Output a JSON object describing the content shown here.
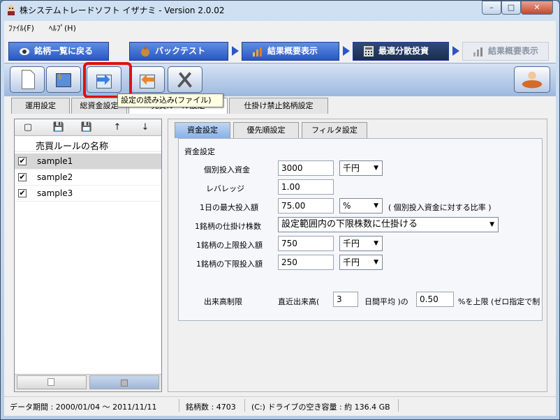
{
  "window": {
    "title": "株システムトレードソフト イザナミ - Version 2.0.02",
    "minimize_glyph": "–",
    "maximize_glyph": "□",
    "close_glyph": "✕"
  },
  "menu": [
    "ﾌｧｲﾙ(F)",
    "ﾍﾙﾌﾟ(H)"
  ],
  "nav_tabs": [
    {
      "label": "銘柄一覧に戻る",
      "icon": "eye-icon"
    },
    {
      "label": "バックテスト",
      "icon": "money-bag-icon"
    },
    {
      "label": "結果概要表示",
      "icon": "chart-icon"
    },
    {
      "label": "最適分散投資",
      "icon": "calculator-icon"
    },
    {
      "label": "結果概要表示",
      "icon": "chart-icon"
    }
  ],
  "toolbar": {
    "tooltip": "設定の読み込み(ファイル)",
    "buttons": [
      "new-document-icon",
      "currency-icon",
      "import-icon",
      "export-icon",
      "tools-icon"
    ],
    "right_button": "trader-icon"
  },
  "sub_tabs": [
    "運用設定",
    "総資金設定",
    "売買ルール設定",
    "仕掛け禁止銘柄設定"
  ],
  "rule_list": {
    "toolbar_glyphs": [
      "▢",
      "💾",
      "💾",
      "↑",
      "↓"
    ],
    "header": "売買ルールの名称",
    "check_glyph": "✔",
    "rows": [
      {
        "name": "sample1",
        "checked": true,
        "selected": true
      },
      {
        "name": "sample2",
        "checked": true,
        "selected": false
      },
      {
        "name": "sample3",
        "checked": true,
        "selected": false
      }
    ]
  },
  "right_tabs": [
    "資金設定",
    "優先順設定",
    "フィルタ設定"
  ],
  "fund": {
    "group_title": "資金設定",
    "fields": [
      {
        "label": "個別投入資金",
        "value": "3000",
        "unit": "千円"
      },
      {
        "label": "レバレッジ",
        "value": "1.00",
        "unit": ""
      },
      {
        "label": "1日の最大投入額",
        "value": "75.00",
        "unit": "%",
        "note": "( 個別投入資金に対する比率 )"
      },
      {
        "label": "1銘柄の仕掛け株数",
        "select": "設定範囲内の下限株数に仕掛ける"
      },
      {
        "label": "1銘柄の上限投入額",
        "value": "750",
        "unit": "千円"
      },
      {
        "label": "1銘柄の下限投入額",
        "value": "250",
        "unit": "千円"
      }
    ],
    "volume": {
      "label": "出来高制限",
      "text1": "直近出来高(",
      "days": "3",
      "text2": "日間平均 )の",
      "ratio": "0.50",
      "text3": "%を上限 (ゼロ指定で制"
    }
  },
  "status": {
    "period": "データ期間 : 2000/01/04 ～ 2011/11/11",
    "count": "銘柄数 : 4703",
    "disk": "(C:) ドライブの空き容量 : 約 136.4 GB"
  },
  "colors": {
    "highlight": "#e01010",
    "nav_blue": "#2a56c6",
    "active_tab": "#1b2c4f"
  }
}
